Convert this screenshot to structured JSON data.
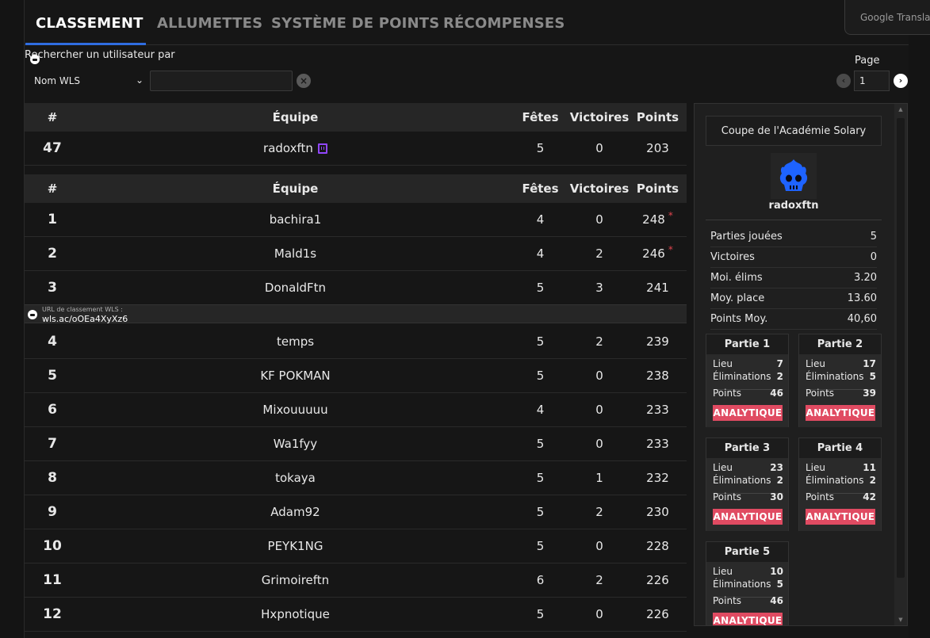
{
  "tabs": [
    "CLASSEMENT",
    "ALLUMETTES",
    "SYSTÈME DE POINTS",
    "RÉCOMPENSES"
  ],
  "google_translate": "Google Translate",
  "search": {
    "label": "Rechercher un utilisateur par",
    "select_value": "Nom WLS",
    "input_value": "",
    "clear_icon": "close-circle-icon"
  },
  "pagination": {
    "label": "Page",
    "value": "1",
    "prev": "‹",
    "next": "›"
  },
  "table_headers": {
    "rank": "#",
    "team": "Équipe",
    "fetes": "Fêtes",
    "victoires": "Victoires",
    "points": "Points"
  },
  "user_row": {
    "rank": "47",
    "team": "radoxftn",
    "fetes": "5",
    "victoires": "0",
    "points": "203"
  },
  "rows": [
    {
      "rank": "1",
      "team": "bachira1",
      "fetes": "4",
      "victoires": "0",
      "points": "248",
      "star": "*"
    },
    {
      "rank": "2",
      "team": "Mald1s",
      "fetes": "4",
      "victoires": "2",
      "points": "246",
      "star": "*"
    },
    {
      "rank": "3",
      "team": "DonaldFtn",
      "fetes": "5",
      "victoires": "3",
      "points": "241",
      "star": ""
    },
    {
      "rank": "4",
      "team": "temps",
      "fetes": "5",
      "victoires": "2",
      "points": "239",
      "star": ""
    },
    {
      "rank": "5",
      "team": "KF POKMAN",
      "fetes": "5",
      "victoires": "0",
      "points": "238",
      "star": ""
    },
    {
      "rank": "6",
      "team": "Mixouuuuu",
      "fetes": "4",
      "victoires": "0",
      "points": "233",
      "star": ""
    },
    {
      "rank": "7",
      "team": "Wa1fyy",
      "fetes": "5",
      "victoires": "0",
      "points": "233",
      "star": ""
    },
    {
      "rank": "8",
      "team": "tokaya",
      "fetes": "5",
      "victoires": "1",
      "points": "232",
      "star": ""
    },
    {
      "rank": "9",
      "team": "Adam92",
      "fetes": "5",
      "victoires": "2",
      "points": "230",
      "star": ""
    },
    {
      "rank": "10",
      "team": "PEYK1NG",
      "fetes": "5",
      "victoires": "0",
      "points": "228",
      "star": ""
    },
    {
      "rank": "11",
      "team": "Grimoireftn",
      "fetes": "6",
      "victoires": "2",
      "points": "226",
      "star": ""
    },
    {
      "rank": "12",
      "team": "Hxpnotique",
      "fetes": "5",
      "victoires": "0",
      "points": "226",
      "star": ""
    }
  ],
  "url_bar": {
    "label": "URL de classement WLS :",
    "link": "wls.ac/oOEa4XyXz6"
  },
  "panel": {
    "cup_name": "Coupe de l'Académie Solary",
    "player": "radoxftn",
    "stats": [
      {
        "label": "Parties jouées",
        "value": "5"
      },
      {
        "label": "Victoires",
        "value": "0"
      },
      {
        "label": "Moi. élims",
        "value": "3.20"
      },
      {
        "label": "Moy. place",
        "value": "13.60"
      },
      {
        "label": "Points Moy.",
        "value": "40,60"
      }
    ],
    "labels": {
      "lieu": "Lieu",
      "elims": "Éliminations",
      "points": "Points",
      "analytics": "ANALYTIQUE"
    },
    "games": [
      {
        "title": "Partie 1",
        "lieu": "7",
        "elims": "2",
        "points": "46"
      },
      {
        "title": "Partie 2",
        "lieu": "17",
        "elims": "5",
        "points": "39"
      },
      {
        "title": "Partie 3",
        "lieu": "23",
        "elims": "2",
        "points": "30"
      },
      {
        "title": "Partie 4",
        "lieu": "11",
        "elims": "2",
        "points": "42"
      },
      {
        "title": "Partie 5",
        "lieu": "10",
        "elims": "5",
        "points": "46"
      }
    ]
  },
  "colors": {
    "accent": "#2f6de1",
    "analytics": "#e04b62",
    "star": "#e0444e",
    "twitch": "#9146ff",
    "avatar_flame": "#1e63ff"
  }
}
